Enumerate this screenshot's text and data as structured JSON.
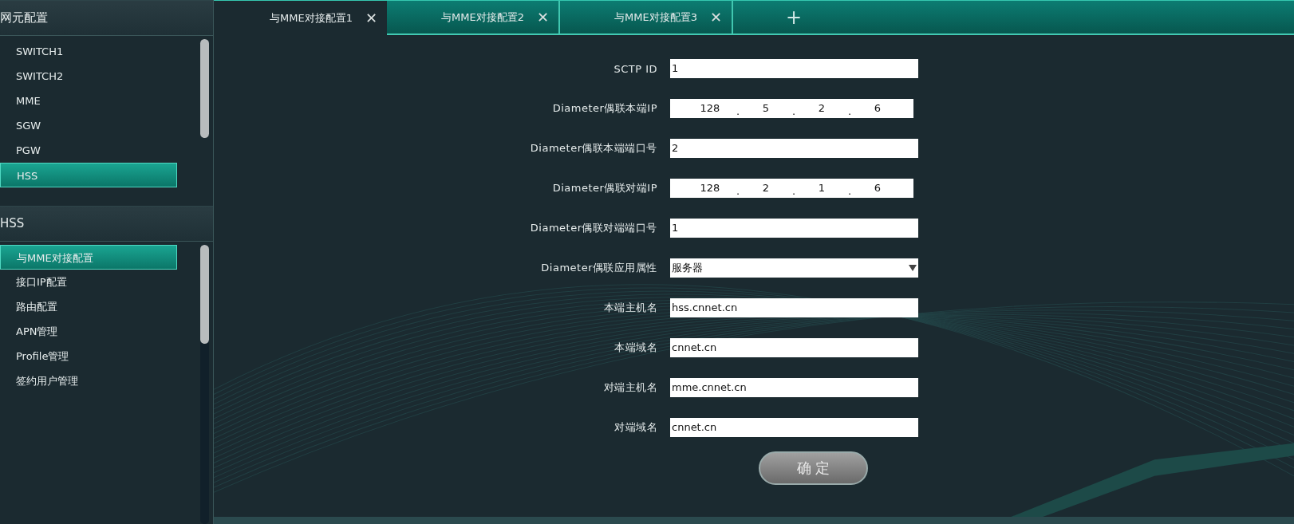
{
  "sidebar": [
    {
      "title": "网元配置",
      "items": [
        {
          "label": "SWITCH1",
          "selected": false
        },
        {
          "label": "SWITCH2",
          "selected": false
        },
        {
          "label": "MME",
          "selected": false
        },
        {
          "label": "SGW",
          "selected": false
        },
        {
          "label": "PGW",
          "selected": false
        },
        {
          "label": "HSS",
          "selected": true
        }
      ]
    },
    {
      "title": "HSS",
      "items": [
        {
          "label": "与MME对接配置",
          "selected": true
        },
        {
          "label": "接口IP配置",
          "selected": false
        },
        {
          "label": "路由配置",
          "selected": false
        },
        {
          "label": "APN管理",
          "selected": false
        },
        {
          "label": "Profile管理",
          "selected": false
        },
        {
          "label": "签约用户管理",
          "selected": false
        }
      ]
    }
  ],
  "tabs": [
    {
      "label": "与MME对接配置1",
      "close": "✕",
      "selected": true
    },
    {
      "label": "与MME对接配置2",
      "close": "✕",
      "selected": false
    },
    {
      "label": "与MME对接配置3",
      "close": "✕",
      "selected": false
    }
  ],
  "add_tab": "+",
  "form": {
    "fields": [
      {
        "kind": "text",
        "label": "SCTP ID",
        "value": "1"
      },
      {
        "kind": "ip",
        "label": "Diameter偶联本端IP",
        "octets": [
          "128",
          "5",
          "2",
          "6"
        ],
        "separator": "."
      },
      {
        "kind": "text",
        "label": "Diameter偶联本端端口号",
        "value": "2"
      },
      {
        "kind": "ip",
        "label": "Diameter偶联对端IP",
        "octets": [
          "128",
          "2",
          "1",
          "6"
        ],
        "separator": "."
      },
      {
        "kind": "text",
        "label": "Diameter偶联对端端口号",
        "value": "1"
      },
      {
        "kind": "select",
        "label": "Diameter偶联应用属性",
        "value": "服务器"
      },
      {
        "kind": "text",
        "label": "本端主机名",
        "value": "hss.cnnet.cn"
      },
      {
        "kind": "text",
        "label": "本端域名",
        "value": "cnnet.cn"
      },
      {
        "kind": "text",
        "label": "对端主机名",
        "value": "mme.cnnet.cn"
      },
      {
        "kind": "text",
        "label": "对端域名",
        "value": "cnnet.cn"
      }
    ],
    "submit": "确 定"
  }
}
